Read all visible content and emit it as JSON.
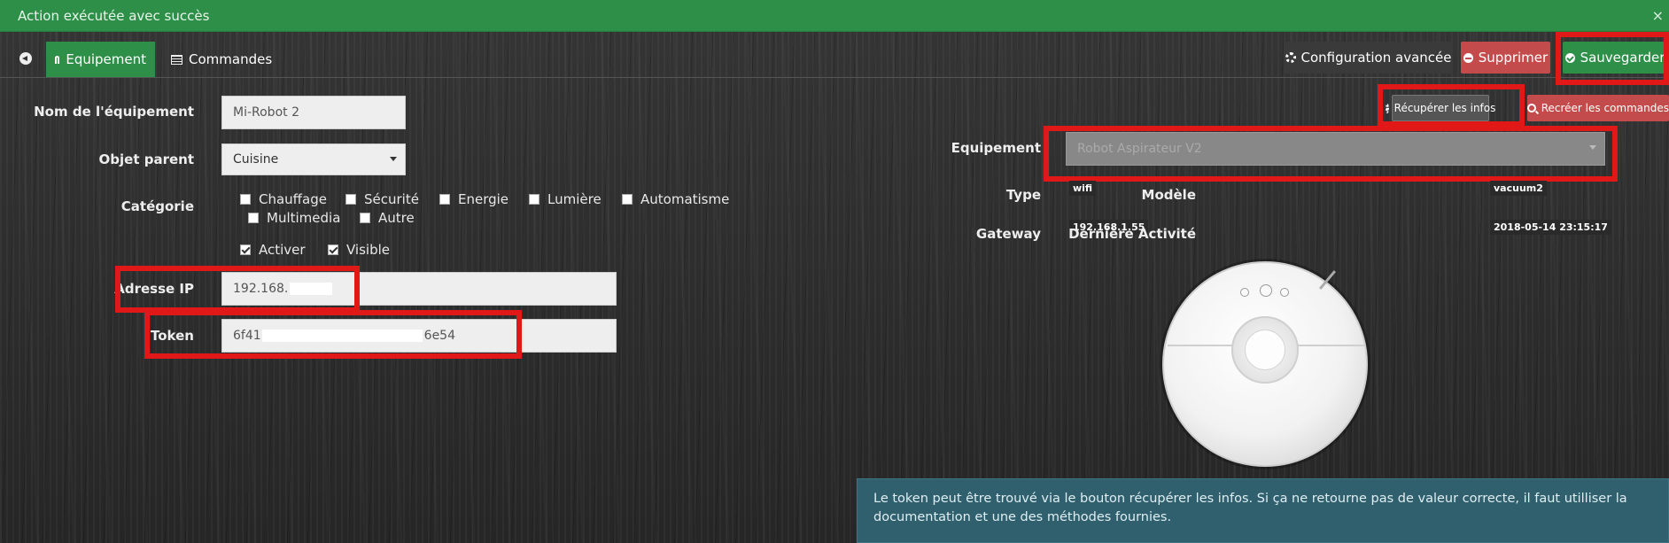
{
  "notification": {
    "message": "Action exécutée avec succès",
    "close": "×"
  },
  "tabs": {
    "equipment": "Equipement",
    "commands": "Commandes"
  },
  "toolbar": {
    "config": "Configuration avancée",
    "delete": "Supprimer",
    "save": "Sauvegarder",
    "fetch": "Récupérer les infos",
    "recreate": "Recréer les commandes"
  },
  "form": {
    "name_label": "Nom de l'équipement",
    "name_value": "Mi-Robot 2",
    "parent_label": "Objet parent",
    "parent_value": "Cuisine",
    "category_label": "Catégorie",
    "categories": [
      "Chauffage",
      "Sécurité",
      "Energie",
      "Lumière",
      "Automatisme",
      "Multimedia",
      "Autre"
    ],
    "activate": "Activer",
    "visible": "Visible",
    "ip_label": "Adresse IP",
    "ip_value": "192.168.",
    "token_label": "Token",
    "token_start": "6f41",
    "token_end": "6e54"
  },
  "device": {
    "equipment_label": "Equipement",
    "equipment_value": "Robot Aspirateur V2",
    "type_label": "Type",
    "type_value": "wifi",
    "model_label": "Modèle",
    "model_value": "vacuum2",
    "gateway_label": "Gateway",
    "gateway_value": "192.168.1.55",
    "last_activity_label": "Dernière Activité",
    "last_activity_value": "2018-05-14 23:15:17"
  },
  "info": "Le token peut être trouvé via le bouton récupérer les infos. Si ça ne retourne pas de valeur correcte, il faut utilliser la documentation et une des méthodes fournies.",
  "colors": {
    "success": "#2e8f49",
    "danger": "#c44b4b",
    "highlight": "#e01818",
    "info": "#30606e"
  }
}
